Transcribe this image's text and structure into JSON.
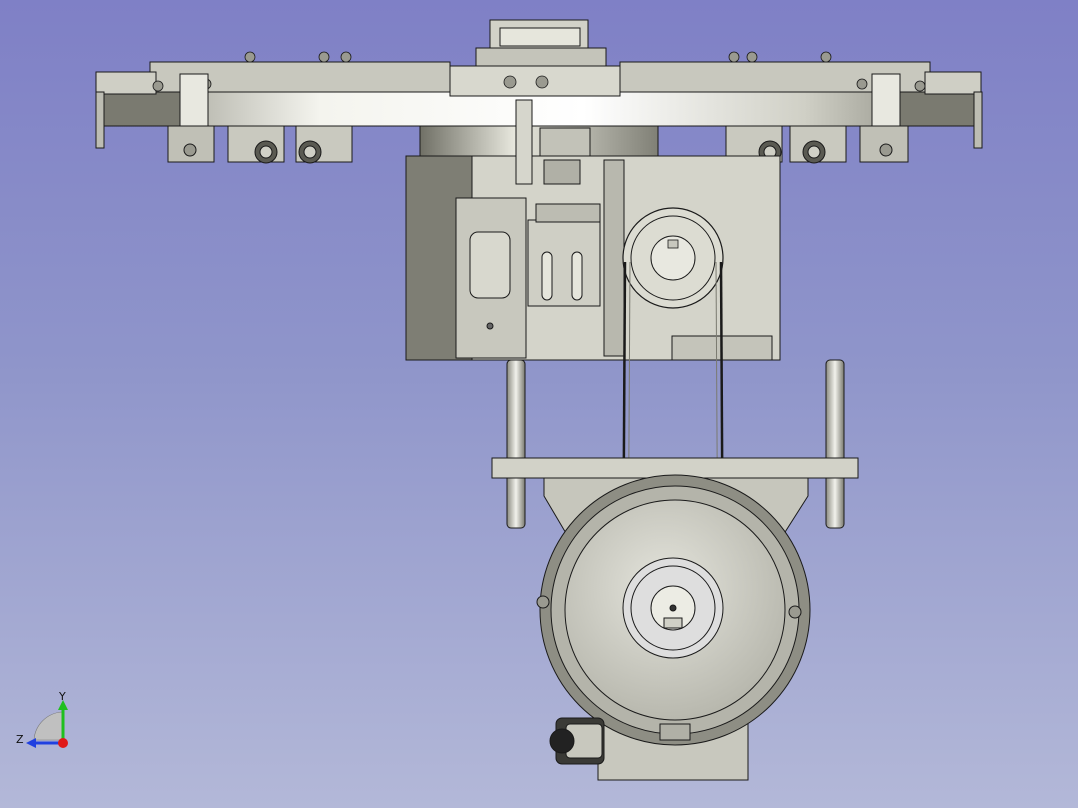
{
  "viewport": {
    "background_top": "#7f80c6",
    "background_bottom": "#b3b8d8",
    "model_fill": "#d6d6cc",
    "model_dark": "#8a8a80",
    "model_edge": "#1a1a1a"
  },
  "model": {
    "parts": [
      "turret-ring",
      "gripper-assemblies",
      "gear-housing",
      "belt-drive",
      "guide-rods",
      "motor-plate",
      "electric-motor",
      "cable-gland"
    ]
  },
  "axes": {
    "y_label": "Y",
    "z_label": "Z",
    "y_color": "#1fbf1f",
    "z_color": "#2040e0",
    "x_color": "#e01818"
  }
}
